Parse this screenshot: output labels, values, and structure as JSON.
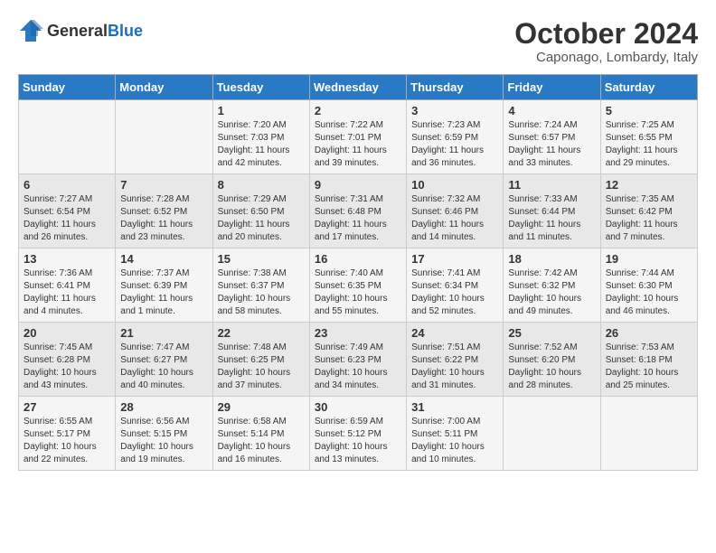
{
  "header": {
    "logo_general": "General",
    "logo_blue": "Blue",
    "title": "October 2024",
    "location": "Caponago, Lombardy, Italy"
  },
  "days_of_week": [
    "Sunday",
    "Monday",
    "Tuesday",
    "Wednesday",
    "Thursday",
    "Friday",
    "Saturday"
  ],
  "weeks": [
    [
      {
        "day": "",
        "content": ""
      },
      {
        "day": "",
        "content": ""
      },
      {
        "day": "1",
        "content": "Sunrise: 7:20 AM\nSunset: 7:03 PM\nDaylight: 11 hours\nand 42 minutes."
      },
      {
        "day": "2",
        "content": "Sunrise: 7:22 AM\nSunset: 7:01 PM\nDaylight: 11 hours\nand 39 minutes."
      },
      {
        "day": "3",
        "content": "Sunrise: 7:23 AM\nSunset: 6:59 PM\nDaylight: 11 hours\nand 36 minutes."
      },
      {
        "day": "4",
        "content": "Sunrise: 7:24 AM\nSunset: 6:57 PM\nDaylight: 11 hours\nand 33 minutes."
      },
      {
        "day": "5",
        "content": "Sunrise: 7:25 AM\nSunset: 6:55 PM\nDaylight: 11 hours\nand 29 minutes."
      }
    ],
    [
      {
        "day": "6",
        "content": "Sunrise: 7:27 AM\nSunset: 6:54 PM\nDaylight: 11 hours\nand 26 minutes."
      },
      {
        "day": "7",
        "content": "Sunrise: 7:28 AM\nSunset: 6:52 PM\nDaylight: 11 hours\nand 23 minutes."
      },
      {
        "day": "8",
        "content": "Sunrise: 7:29 AM\nSunset: 6:50 PM\nDaylight: 11 hours\nand 20 minutes."
      },
      {
        "day": "9",
        "content": "Sunrise: 7:31 AM\nSunset: 6:48 PM\nDaylight: 11 hours\nand 17 minutes."
      },
      {
        "day": "10",
        "content": "Sunrise: 7:32 AM\nSunset: 6:46 PM\nDaylight: 11 hours\nand 14 minutes."
      },
      {
        "day": "11",
        "content": "Sunrise: 7:33 AM\nSunset: 6:44 PM\nDaylight: 11 hours\nand 11 minutes."
      },
      {
        "day": "12",
        "content": "Sunrise: 7:35 AM\nSunset: 6:42 PM\nDaylight: 11 hours\nand 7 minutes."
      }
    ],
    [
      {
        "day": "13",
        "content": "Sunrise: 7:36 AM\nSunset: 6:41 PM\nDaylight: 11 hours\nand 4 minutes."
      },
      {
        "day": "14",
        "content": "Sunrise: 7:37 AM\nSunset: 6:39 PM\nDaylight: 11 hours\nand 1 minute."
      },
      {
        "day": "15",
        "content": "Sunrise: 7:38 AM\nSunset: 6:37 PM\nDaylight: 10 hours\nand 58 minutes."
      },
      {
        "day": "16",
        "content": "Sunrise: 7:40 AM\nSunset: 6:35 PM\nDaylight: 10 hours\nand 55 minutes."
      },
      {
        "day": "17",
        "content": "Sunrise: 7:41 AM\nSunset: 6:34 PM\nDaylight: 10 hours\nand 52 minutes."
      },
      {
        "day": "18",
        "content": "Sunrise: 7:42 AM\nSunset: 6:32 PM\nDaylight: 10 hours\nand 49 minutes."
      },
      {
        "day": "19",
        "content": "Sunrise: 7:44 AM\nSunset: 6:30 PM\nDaylight: 10 hours\nand 46 minutes."
      }
    ],
    [
      {
        "day": "20",
        "content": "Sunrise: 7:45 AM\nSunset: 6:28 PM\nDaylight: 10 hours\nand 43 minutes."
      },
      {
        "day": "21",
        "content": "Sunrise: 7:47 AM\nSunset: 6:27 PM\nDaylight: 10 hours\nand 40 minutes."
      },
      {
        "day": "22",
        "content": "Sunrise: 7:48 AM\nSunset: 6:25 PM\nDaylight: 10 hours\nand 37 minutes."
      },
      {
        "day": "23",
        "content": "Sunrise: 7:49 AM\nSunset: 6:23 PM\nDaylight: 10 hours\nand 34 minutes."
      },
      {
        "day": "24",
        "content": "Sunrise: 7:51 AM\nSunset: 6:22 PM\nDaylight: 10 hours\nand 31 minutes."
      },
      {
        "day": "25",
        "content": "Sunrise: 7:52 AM\nSunset: 6:20 PM\nDaylight: 10 hours\nand 28 minutes."
      },
      {
        "day": "26",
        "content": "Sunrise: 7:53 AM\nSunset: 6:18 PM\nDaylight: 10 hours\nand 25 minutes."
      }
    ],
    [
      {
        "day": "27",
        "content": "Sunrise: 6:55 AM\nSunset: 5:17 PM\nDaylight: 10 hours\nand 22 minutes."
      },
      {
        "day": "28",
        "content": "Sunrise: 6:56 AM\nSunset: 5:15 PM\nDaylight: 10 hours\nand 19 minutes."
      },
      {
        "day": "29",
        "content": "Sunrise: 6:58 AM\nSunset: 5:14 PM\nDaylight: 10 hours\nand 16 minutes."
      },
      {
        "day": "30",
        "content": "Sunrise: 6:59 AM\nSunset: 5:12 PM\nDaylight: 10 hours\nand 13 minutes."
      },
      {
        "day": "31",
        "content": "Sunrise: 7:00 AM\nSunset: 5:11 PM\nDaylight: 10 hours\nand 10 minutes."
      },
      {
        "day": "",
        "content": ""
      },
      {
        "day": "",
        "content": ""
      }
    ]
  ]
}
